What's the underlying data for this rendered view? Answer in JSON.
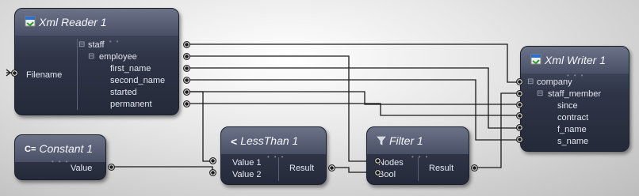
{
  "nodes": {
    "xml_reader": {
      "title": "Xml Reader 1",
      "input_label": "Filename",
      "tree": [
        "staff",
        "employee",
        "first_name",
        "second_name",
        "started",
        "permanent"
      ]
    },
    "xml_writer": {
      "title": "Xml Writer 1",
      "tree": [
        "company",
        "staff_member",
        "since",
        "contract",
        "f_name",
        "s_name"
      ]
    },
    "constant": {
      "title": "Constant 1",
      "output_label": "Value"
    },
    "less_than": {
      "title": "LessThan 1",
      "inputs": [
        "Value 1",
        "Value 2"
      ],
      "output_label": "Result"
    },
    "filter": {
      "title": "Filter 1",
      "inputs": [
        "Nodes",
        "Bool"
      ],
      "output_label": "Result"
    }
  },
  "icons": {
    "xml_reader": "xml-file-icon",
    "xml_writer": "xml-file-icon",
    "constant": "constant-icon",
    "less_than": "less-than-icon",
    "filter": "funnel-icon"
  },
  "colors": {
    "node_body": "#2f3547",
    "node_title": "#5a627a",
    "wire": "#1a1a1a",
    "background": "#e0e0e0"
  }
}
